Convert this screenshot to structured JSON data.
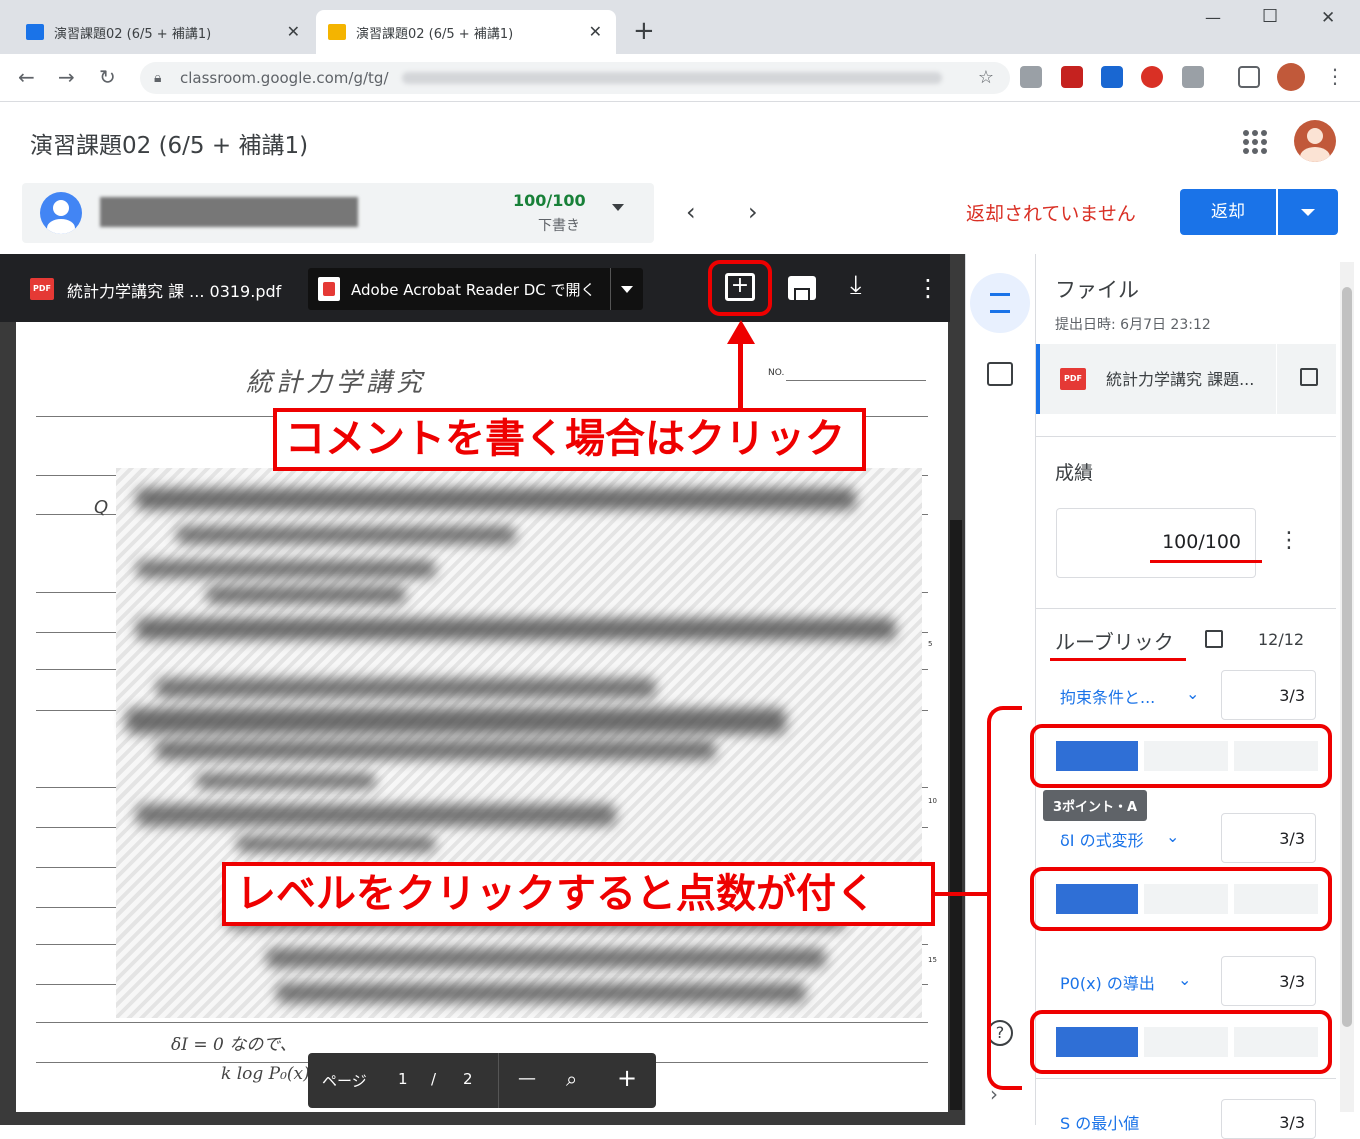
{
  "browser": {
    "tabs": [
      {
        "title": "演習課題02 (6/5 + 補講1)"
      },
      {
        "title": "演習課題02 (6/5 + 補講1)"
      }
    ],
    "new_tab": "+",
    "url": "classroom.google.com/g/tg/",
    "window_controls": {
      "minimize": "—",
      "maximize": "☐",
      "close": "✕"
    }
  },
  "header": {
    "title": "演習課題02 (6/5 + 補講1)"
  },
  "student": {
    "score": "100/100",
    "status": "下書き",
    "not_returned": "返却されていません",
    "return_button": "返却"
  },
  "viewer": {
    "filename": "統計力学講究 課 ... 0319.pdf",
    "open_with": "Adobe Acrobat Reader DC で開く",
    "pdf_badge": "PDF",
    "handwritten_title": "統計力学講究",
    "no_label": "NO.",
    "margin_numbers": [
      "5",
      "10",
      "15"
    ],
    "page_label": "ページ",
    "page_current": "1",
    "page_sep": "/",
    "page_total": "2",
    "zoom_minus": "—",
    "zoom_plus": "+",
    "bottom_notes": [
      "δI = 0 なので、",
      "k log P₀(x)"
    ]
  },
  "side": {
    "file_heading": "ファイル",
    "submitted": "提出日時: 6月7日 23:12",
    "file_name": "統計力学講究 課題...",
    "grade_heading": "成績",
    "grade_value": "100/100",
    "rubric_heading": "ルーブリック",
    "rubric_total": "12/12",
    "criteria": [
      {
        "name": "拘束条件と...",
        "score": "3/3"
      },
      {
        "name": "δI の式変形",
        "score": "3/3"
      },
      {
        "name": "P0(x) の導出",
        "score": "3/3"
      },
      {
        "name": "S の最小値",
        "score": "3/3"
      }
    ],
    "tooltip": "3ポイント・A"
  },
  "annotations": {
    "comment_callout": "コメントを書く場合はクリック",
    "level_callout": "レベルをクリックすると点数が付く"
  },
  "colors": {
    "accent": "#1a73e8",
    "level_selected": "#2f6fd6",
    "annotation_red": "#e00000",
    "not_returned_red": "#d93025"
  }
}
